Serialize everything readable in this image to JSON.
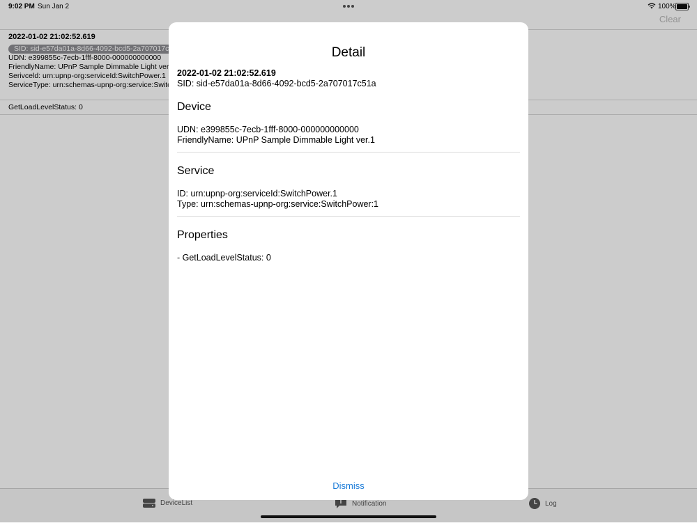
{
  "status_bar": {
    "time": "9:02 PM",
    "date": "Sun Jan 2",
    "battery": "100%"
  },
  "nav": {
    "clear_label": "Clear"
  },
  "background_log": {
    "time": "2022-01-02 21:02:52.619",
    "sid": "SID: sid-e57da01a-8d66-4092-bcd5-2a707017c51a",
    "udn": "UDN: e399855c-7ecb-1fff-8000-000000000000",
    "friendly_name": "FriendlyName: UPnP Sample Dimmable Light ver.1",
    "service_id": "Serivceld: urn:upnp-org:serviceId:SwitchPower.1",
    "service_type": "ServiceType: urn:schemas-upnp-org:service:SwitchPower:1",
    "property": "GetLoadLevelStatus: 0"
  },
  "tabs": [
    {
      "label": "DeviceList",
      "icon": "device-list-icon"
    },
    {
      "label": "Notification",
      "icon": "notification-icon"
    },
    {
      "label": "Log",
      "icon": "clock-icon"
    }
  ],
  "modal": {
    "title": "Detail",
    "time": "2022-01-02 21:02:52.619",
    "sid": "SID: sid-e57da01a-8d66-4092-bcd5-2a707017c51a",
    "device": {
      "title": "Device",
      "udn": "UDN: e399855c-7ecb-1fff-8000-000000000000",
      "friendly_name": "FriendlyName: UPnP Sample Dimmable Light ver.1"
    },
    "service": {
      "title": "Service",
      "id": "ID: urn:upnp-org:serviceId:SwitchPower.1",
      "type": "Type: urn:schemas-upnp-org:service:SwitchPower:1"
    },
    "properties": {
      "title": "Properties",
      "items": [
        "- GetLoadLevelStatus: 0"
      ]
    },
    "dismiss_label": "Dismiss"
  },
  "colors": {
    "accent": "#1a7bd8",
    "badge": "#8e8e93"
  }
}
